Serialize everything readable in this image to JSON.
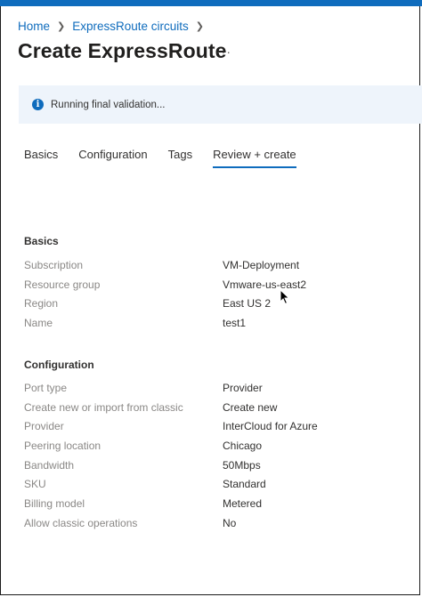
{
  "breadcrumb": [
    "Home",
    "ExpressRoute circuits"
  ],
  "page": {
    "title": "Create ExpressRoute",
    "more": "···"
  },
  "banner": {
    "text": "Running final validation..."
  },
  "tabs": [
    {
      "label": "Basics"
    },
    {
      "label": "Configuration"
    },
    {
      "label": "Tags"
    },
    {
      "label": "Review + create",
      "active": true
    }
  ],
  "basics": {
    "title": "Basics",
    "rows": [
      {
        "label": "Subscription",
        "value": "VM-Deployment"
      },
      {
        "label": "Resource group",
        "value": "Vmware-us-east2"
      },
      {
        "label": "Region",
        "value": "East US 2"
      },
      {
        "label": "Name",
        "value": "test1"
      }
    ]
  },
  "configuration": {
    "title": "Configuration",
    "rows": [
      {
        "label": "Port type",
        "value": "Provider"
      },
      {
        "label": "Create new or import from classic",
        "value": "Create new"
      },
      {
        "label": "Provider",
        "value": "InterCloud for Azure"
      },
      {
        "label": "Peering location",
        "value": "Chicago"
      },
      {
        "label": "Bandwidth",
        "value": "50Mbps"
      },
      {
        "label": "SKU",
        "value": "Standard"
      },
      {
        "label": "Billing model",
        "value": "Metered"
      },
      {
        "label": "Allow classic operations",
        "value": "No"
      }
    ]
  },
  "colors": {
    "accent": "#0f6cbd",
    "banner_bg": "#eef4fb",
    "label": "#8a8886"
  }
}
